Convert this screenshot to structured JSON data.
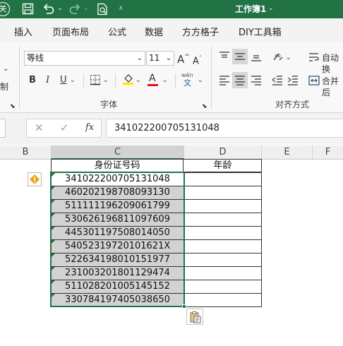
{
  "title_bar": {
    "workbook_title": "工作簿1",
    "close_partial": "关"
  },
  "tabs": [
    "插入",
    "页面布局",
    "公式",
    "数据",
    "方方格子",
    "DIY工具箱"
  ],
  "font_group": {
    "font_name": "等线",
    "font_size": "11",
    "group_label": "字体",
    "grow_label": "A",
    "shrink_label": "A",
    "bold": "B",
    "italic": "I",
    "underline": "U",
    "font_color_label": "A",
    "phonetic_top": "wén",
    "phonetic_bottom": "文"
  },
  "align_group": {
    "group_label": "对齐方式",
    "wrap_text": "自动换",
    "merge_center": "合并后"
  },
  "left_group": {
    "partial_label": "制"
  },
  "formula_bar": {
    "fx_label": "fx",
    "value": "341022200705131048"
  },
  "columns": [
    "B",
    "C",
    "D",
    "E",
    "F"
  ],
  "headers": {
    "id_header": "身份证号码",
    "age_header": "年龄"
  },
  "id_numbers": [
    "341022200705131048",
    "460202198708093130",
    "511111196209061799",
    "530626196811097609",
    "445301197508014050",
    "54052319720101621X",
    "522634198010151977",
    "231003201801129474",
    "511028201005145152",
    "330784197405038650"
  ],
  "colors": {
    "excel_green": "#217346",
    "selection_border": "#217346",
    "cell_fill": "#d2d2d2",
    "warning": "#e8a317",
    "fill_yellow": "#ffe600",
    "font_red": "#e81123"
  }
}
